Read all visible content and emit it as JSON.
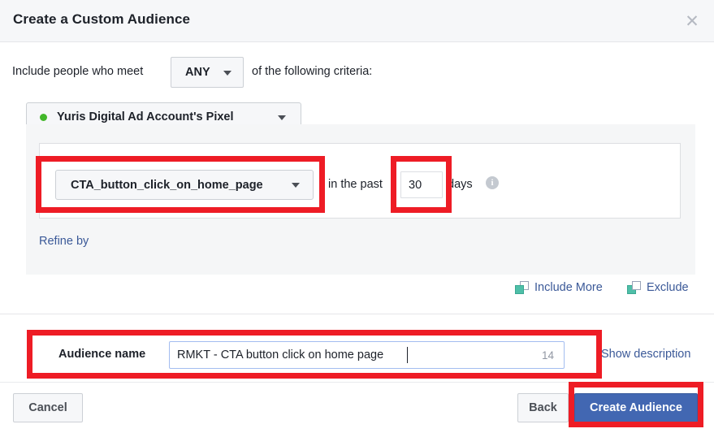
{
  "dialog": {
    "title": "Create a Custom Audience",
    "close_icon": "close-icon"
  },
  "criteria_intro": {
    "text_before": "Include people who meet",
    "operator": "ANY",
    "text_after": "of the following criteria:"
  },
  "pixel_source": {
    "label": "Yuris Digital Ad Account's Pixel",
    "status_dot": "#42b72a"
  },
  "rule": {
    "event": "CTA_button_click_on_home_page",
    "in_past_label": "in the past",
    "retention_days": "30",
    "days_label": "days",
    "info_icon": "info-icon",
    "refine_link": "Refine by"
  },
  "set_actions": {
    "include_more": "Include More",
    "exclude": "Exclude",
    "icon_color": "#4fbfa8"
  },
  "audience_name": {
    "label": "Audience name",
    "value": "RMKT - CTA button click on home page",
    "char_count": "14",
    "show_description": "Show description"
  },
  "footer": {
    "cancel": "Cancel",
    "back": "Back",
    "create": "Create Audience",
    "primary_color": "#4267b2"
  },
  "annotations": {
    "highlight_color": "#ee1c25",
    "boxes": [
      "event-dropdown",
      "retention-days",
      "audience-name",
      "create-audience-button"
    ]
  }
}
